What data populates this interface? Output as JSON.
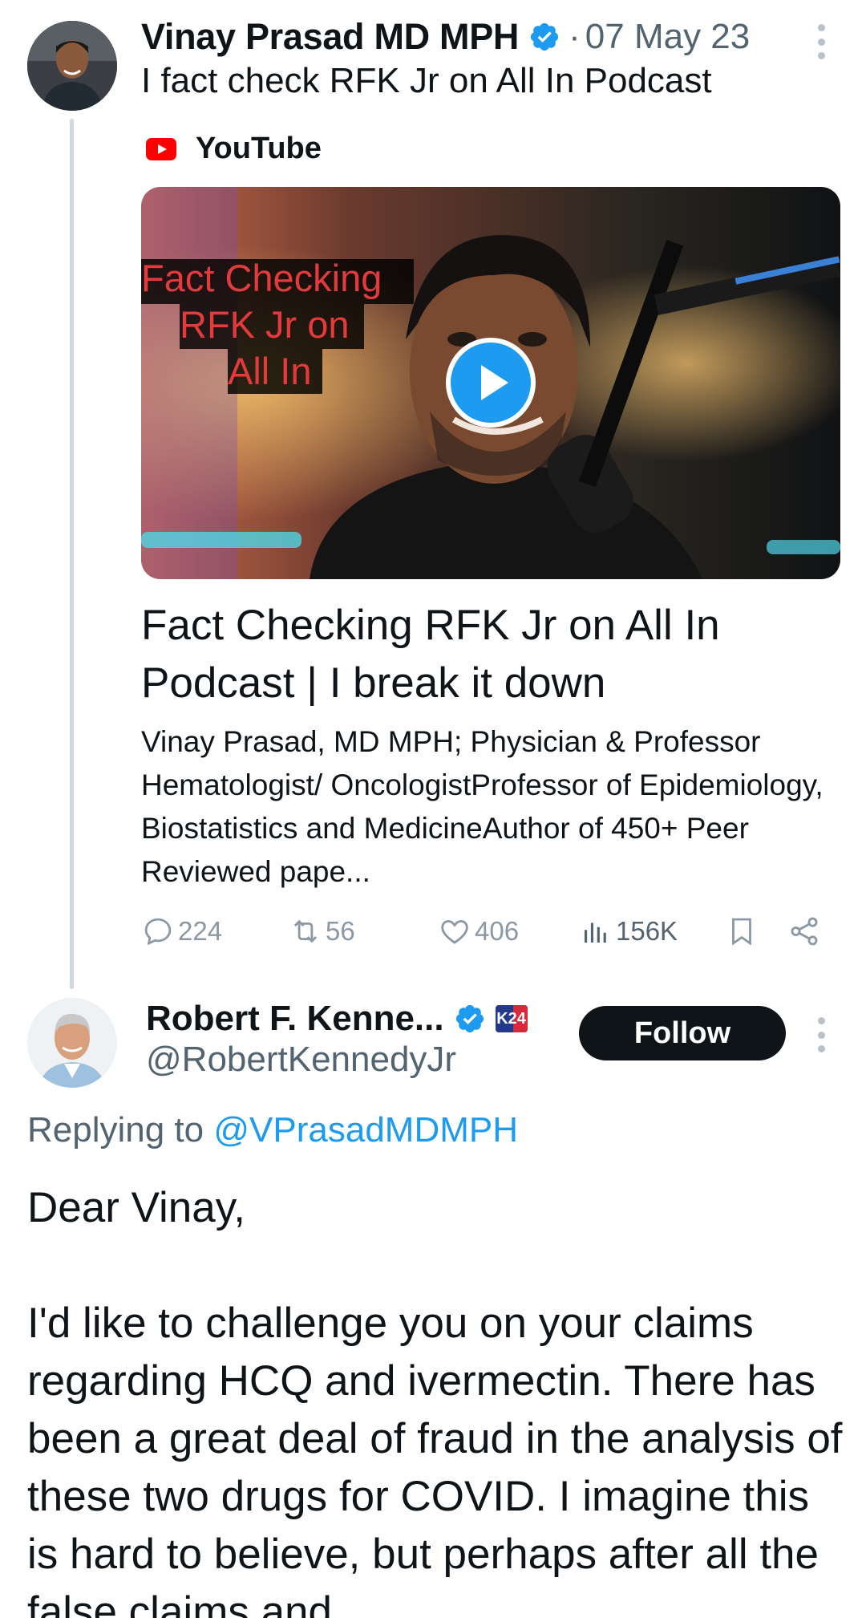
{
  "parent_tweet": {
    "author_name": "Vinay Prasad MD MPH",
    "separator": "·",
    "date": "07 May 23",
    "text": "I fact check RFK Jr on All In Podcast",
    "link_card": {
      "source": "YouTube",
      "thumbnail_overlay_lines": [
        "Fact Checking",
        "RFK Jr on",
        "All In"
      ],
      "title": "Fact Checking RFK Jr on All In Podcast | I break it down",
      "description": "Vinay Prasad, MD MPH; Physician & Professor Hematologist/ OncologistProfessor of Epidemiology, Biostatistics and MedicineAuthor of 450+ Peer Reviewed pape..."
    },
    "stats": {
      "replies": "224",
      "reposts": "56",
      "likes": "406",
      "views": "156K"
    }
  },
  "reply_tweet": {
    "author_name": "Robert F. Kenne...",
    "handle": "@RobertKennedyJr",
    "badge_text": "K24",
    "follow_label": "Follow",
    "replying_prefix": "Replying to",
    "replying_handle": "@VPrasadMDMPH",
    "body_greeting": "Dear Vinay,",
    "body_paragraph": "I'd like to challenge you on your claims regarding HCQ and ivermectin. There has been a great deal of fraud in the analysis of these two drugs for COVID. I imagine this is hard to believe, but perhaps after all the false claims and"
  },
  "colors": {
    "accent": "#1d9bf0",
    "text": "#0f1419",
    "secondary": "#536471",
    "icon_muted": "#8b98a5",
    "youtube_red": "#ff0000"
  },
  "icons": {
    "verified": "verified-badge-icon",
    "more": "more-vertical-icon",
    "play": "play-icon",
    "reply": "reply-icon",
    "repost": "repost-icon",
    "like": "heart-icon",
    "views": "views-bar-chart-icon",
    "bookmark": "bookmark-icon",
    "share": "share-icon"
  }
}
